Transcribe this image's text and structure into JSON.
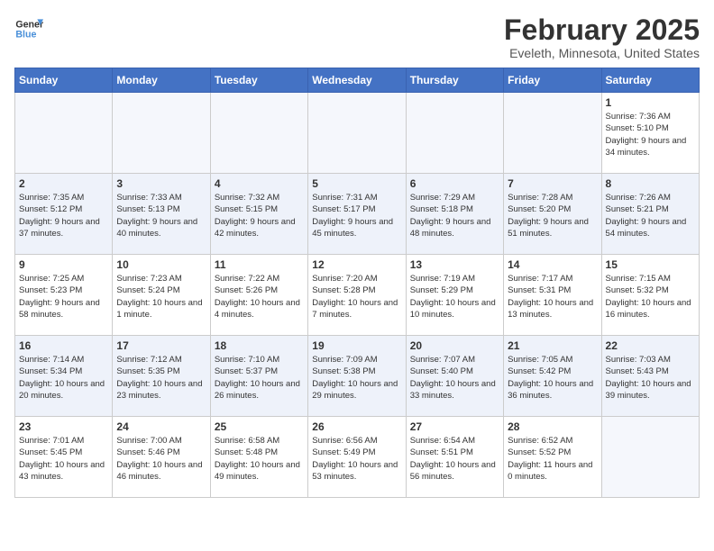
{
  "header": {
    "logo_line1": "General",
    "logo_line2": "Blue",
    "month": "February 2025",
    "location": "Eveleth, Minnesota, United States"
  },
  "weekdays": [
    "Sunday",
    "Monday",
    "Tuesday",
    "Wednesday",
    "Thursday",
    "Friday",
    "Saturday"
  ],
  "weeks": [
    [
      {
        "day": "",
        "info": ""
      },
      {
        "day": "",
        "info": ""
      },
      {
        "day": "",
        "info": ""
      },
      {
        "day": "",
        "info": ""
      },
      {
        "day": "",
        "info": ""
      },
      {
        "day": "",
        "info": ""
      },
      {
        "day": "1",
        "info": "Sunrise: 7:36 AM\nSunset: 5:10 PM\nDaylight: 9 hours and 34 minutes."
      }
    ],
    [
      {
        "day": "2",
        "info": "Sunrise: 7:35 AM\nSunset: 5:12 PM\nDaylight: 9 hours and 37 minutes."
      },
      {
        "day": "3",
        "info": "Sunrise: 7:33 AM\nSunset: 5:13 PM\nDaylight: 9 hours and 40 minutes."
      },
      {
        "day": "4",
        "info": "Sunrise: 7:32 AM\nSunset: 5:15 PM\nDaylight: 9 hours and 42 minutes."
      },
      {
        "day": "5",
        "info": "Sunrise: 7:31 AM\nSunset: 5:17 PM\nDaylight: 9 hours and 45 minutes."
      },
      {
        "day": "6",
        "info": "Sunrise: 7:29 AM\nSunset: 5:18 PM\nDaylight: 9 hours and 48 minutes."
      },
      {
        "day": "7",
        "info": "Sunrise: 7:28 AM\nSunset: 5:20 PM\nDaylight: 9 hours and 51 minutes."
      },
      {
        "day": "8",
        "info": "Sunrise: 7:26 AM\nSunset: 5:21 PM\nDaylight: 9 hours and 54 minutes."
      }
    ],
    [
      {
        "day": "9",
        "info": "Sunrise: 7:25 AM\nSunset: 5:23 PM\nDaylight: 9 hours and 58 minutes."
      },
      {
        "day": "10",
        "info": "Sunrise: 7:23 AM\nSunset: 5:24 PM\nDaylight: 10 hours and 1 minute."
      },
      {
        "day": "11",
        "info": "Sunrise: 7:22 AM\nSunset: 5:26 PM\nDaylight: 10 hours and 4 minutes."
      },
      {
        "day": "12",
        "info": "Sunrise: 7:20 AM\nSunset: 5:28 PM\nDaylight: 10 hours and 7 minutes."
      },
      {
        "day": "13",
        "info": "Sunrise: 7:19 AM\nSunset: 5:29 PM\nDaylight: 10 hours and 10 minutes."
      },
      {
        "day": "14",
        "info": "Sunrise: 7:17 AM\nSunset: 5:31 PM\nDaylight: 10 hours and 13 minutes."
      },
      {
        "day": "15",
        "info": "Sunrise: 7:15 AM\nSunset: 5:32 PM\nDaylight: 10 hours and 16 minutes."
      }
    ],
    [
      {
        "day": "16",
        "info": "Sunrise: 7:14 AM\nSunset: 5:34 PM\nDaylight: 10 hours and 20 minutes."
      },
      {
        "day": "17",
        "info": "Sunrise: 7:12 AM\nSunset: 5:35 PM\nDaylight: 10 hours and 23 minutes."
      },
      {
        "day": "18",
        "info": "Sunrise: 7:10 AM\nSunset: 5:37 PM\nDaylight: 10 hours and 26 minutes."
      },
      {
        "day": "19",
        "info": "Sunrise: 7:09 AM\nSunset: 5:38 PM\nDaylight: 10 hours and 29 minutes."
      },
      {
        "day": "20",
        "info": "Sunrise: 7:07 AM\nSunset: 5:40 PM\nDaylight: 10 hours and 33 minutes."
      },
      {
        "day": "21",
        "info": "Sunrise: 7:05 AM\nSunset: 5:42 PM\nDaylight: 10 hours and 36 minutes."
      },
      {
        "day": "22",
        "info": "Sunrise: 7:03 AM\nSunset: 5:43 PM\nDaylight: 10 hours and 39 minutes."
      }
    ],
    [
      {
        "day": "23",
        "info": "Sunrise: 7:01 AM\nSunset: 5:45 PM\nDaylight: 10 hours and 43 minutes."
      },
      {
        "day": "24",
        "info": "Sunrise: 7:00 AM\nSunset: 5:46 PM\nDaylight: 10 hours and 46 minutes."
      },
      {
        "day": "25",
        "info": "Sunrise: 6:58 AM\nSunset: 5:48 PM\nDaylight: 10 hours and 49 minutes."
      },
      {
        "day": "26",
        "info": "Sunrise: 6:56 AM\nSunset: 5:49 PM\nDaylight: 10 hours and 53 minutes."
      },
      {
        "day": "27",
        "info": "Sunrise: 6:54 AM\nSunset: 5:51 PM\nDaylight: 10 hours and 56 minutes."
      },
      {
        "day": "28",
        "info": "Sunrise: 6:52 AM\nSunset: 5:52 PM\nDaylight: 11 hours and 0 minutes."
      },
      {
        "day": "",
        "info": ""
      }
    ]
  ]
}
